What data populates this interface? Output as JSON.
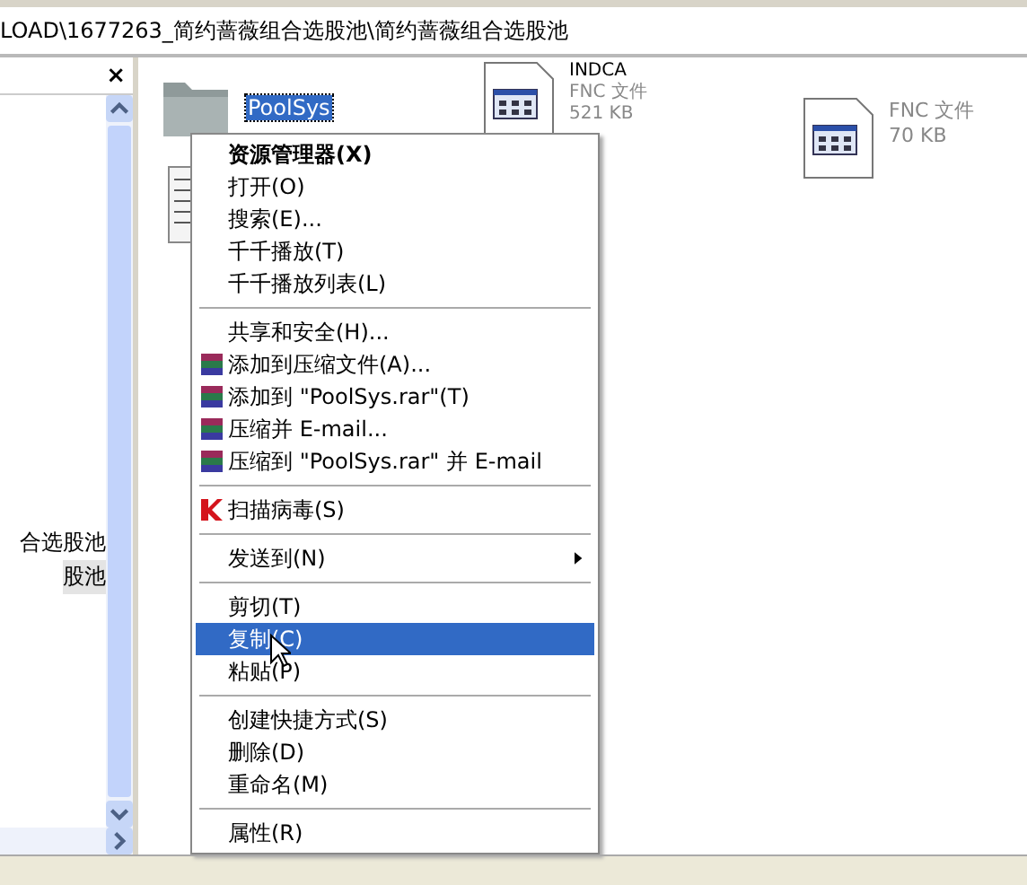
{
  "address_bar": {
    "path": "LOAD\\1677263_简约蔷薇组合选股池\\简约蔷薇组合选股池"
  },
  "folder_pane": {
    "close": "×",
    "items": [
      {
        "label": "合选股池",
        "selected": false
      },
      {
        "label": "股池",
        "selected": true
      }
    ]
  },
  "files": [
    {
      "kind": "folder",
      "name": "PoolSys",
      "selected": true
    },
    {
      "kind": "fnc",
      "name": "INDCA",
      "type": "FNC 文件",
      "size": "521 KB"
    },
    {
      "kind": "fnc",
      "type": "FNC 文件",
      "size": "70 KB"
    },
    {
      "kind": "text"
    }
  ],
  "context_menu": {
    "items": [
      {
        "kind": "item",
        "label": "资源管理器(X)",
        "bold": true,
        "selected": false
      },
      {
        "kind": "item",
        "label": "打开(O)",
        "selected": false
      },
      {
        "kind": "item",
        "label": "搜索(E)...",
        "selected": false
      },
      {
        "kind": "item",
        "label": "千千播放(T)",
        "selected": false
      },
      {
        "kind": "item",
        "label": "千千播放列表(L)",
        "selected": false
      },
      {
        "kind": "separator"
      },
      {
        "kind": "item",
        "label": "共享和安全(H)...",
        "selected": false
      },
      {
        "kind": "archive",
        "label": "添加到压缩文件(A)...",
        "selected": false
      },
      {
        "kind": "archive",
        "label": "添加到 \"PoolSys.rar\"(T)",
        "selected": false
      },
      {
        "kind": "archive",
        "label": "压缩并 E-mail...",
        "selected": false
      },
      {
        "kind": "archive",
        "label": "压缩到 \"PoolSys.rar\" 并 E-mail",
        "selected": false
      },
      {
        "kind": "separator"
      },
      {
        "kind": "scan",
        "label": "扫描病毒(S)",
        "selected": false
      },
      {
        "kind": "separator"
      },
      {
        "kind": "item",
        "label": "发送到(N)",
        "submenu": true,
        "selected": false
      },
      {
        "kind": "separator"
      },
      {
        "kind": "item",
        "label": "剪切(T)",
        "selected": false
      },
      {
        "kind": "item",
        "label": "复制(C)",
        "selected": true
      },
      {
        "kind": "item",
        "label": "粘贴(P)",
        "selected": false
      },
      {
        "kind": "separator"
      },
      {
        "kind": "item",
        "label": "创建快捷方式(S)",
        "selected": false
      },
      {
        "kind": "item",
        "label": "删除(D)",
        "selected": false
      },
      {
        "kind": "item",
        "label": "重命名(M)",
        "selected": false
      },
      {
        "kind": "separator"
      },
      {
        "kind": "item",
        "label": "属性(R)",
        "selected": false
      }
    ]
  }
}
